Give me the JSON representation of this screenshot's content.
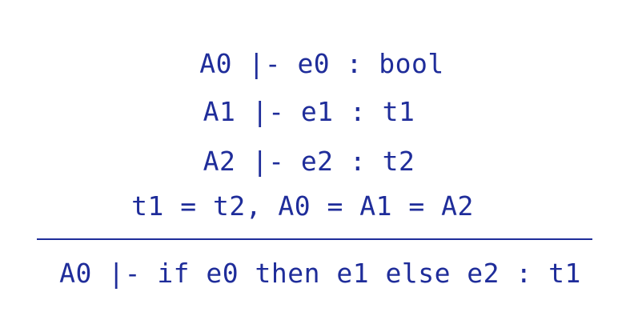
{
  "rule": {
    "premises": [
      "A0 |- e0 : bool",
      "A1 |- e1 : t1",
      "A2 |- e2 : t2",
      "t1 = t2, A0 = A1 = A2"
    ],
    "conclusion": "A0 |- if e0 then e1 else e2 : t1"
  },
  "colors": {
    "text": "#1f2d9a",
    "background": "#ffffff"
  }
}
